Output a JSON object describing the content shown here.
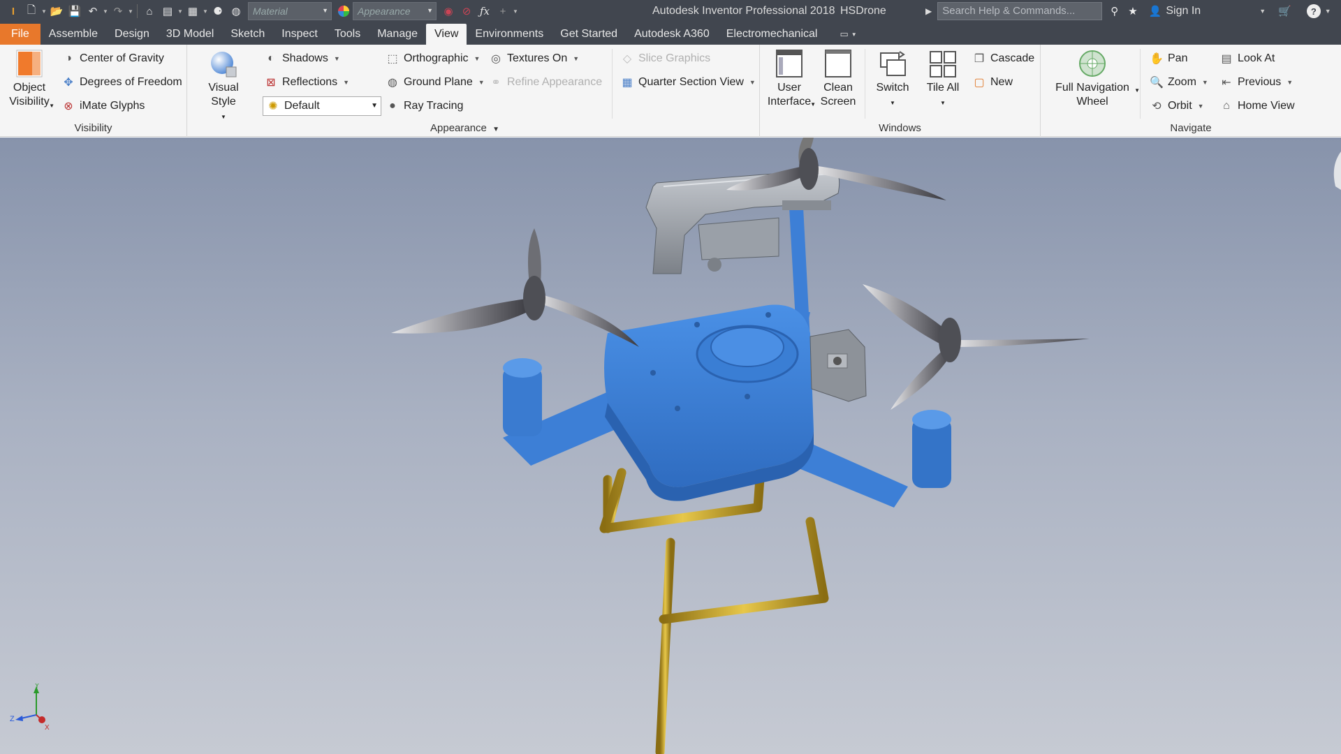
{
  "titlebar": {
    "material_placeholder": "Material",
    "appearance_placeholder": "Appearance",
    "app_title": "Autodesk Inventor Professional 2018",
    "doc_name": "HSDrone",
    "search_placeholder": "Search Help & Commands...",
    "sign_in": "Sign In"
  },
  "tabs": [
    "File",
    "Assemble",
    "Design",
    "3D Model",
    "Sketch",
    "Inspect",
    "Tools",
    "Manage",
    "View",
    "Environments",
    "Get Started",
    "Autodesk A360",
    "Electromechanical"
  ],
  "active_tab": "View",
  "ribbon": {
    "visibility": {
      "title": "Visibility",
      "object_visibility": [
        "Object",
        "Visibility"
      ],
      "center_of_gravity": "Center of Gravity",
      "degrees_of_freedom": "Degrees of Freedom",
      "imate_glyphs": "iMate Glyphs"
    },
    "appearance": {
      "title": "Appearance",
      "visual_style": "Visual Style",
      "shadows": "Shadows",
      "reflections": "Reflections",
      "default_combo": "Default",
      "orthographic": "Orthographic",
      "ground_plane": "Ground Plane",
      "ray_tracing": "Ray Tracing",
      "textures_on": "Textures On",
      "refine_appearance": "Refine Appearance",
      "slice_graphics": "Slice Graphics",
      "quarter_section_view": "Quarter Section View"
    },
    "windows": {
      "title": "Windows",
      "user_interface": [
        "User",
        "Interface"
      ],
      "clean_screen": [
        "Clean",
        "Screen"
      ],
      "switch": "Switch",
      "tile_all": "Tile All",
      "cascade": "Cascade",
      "new": "New"
    },
    "navigate": {
      "title": "Navigate",
      "full_nav_wheel": [
        "Full Navigation",
        "Wheel"
      ],
      "pan": "Pan",
      "zoom": "Zoom",
      "orbit": "Orbit",
      "look_at": "Look At",
      "previous": "Previous",
      "home_view": "Home View"
    }
  },
  "triad": {
    "x": "X",
    "y": "Y",
    "z": "Z"
  },
  "colors": {
    "drone_body": "#3b7fd4",
    "file_tab": "#e8782b",
    "landing_gear": "#c9a833"
  }
}
